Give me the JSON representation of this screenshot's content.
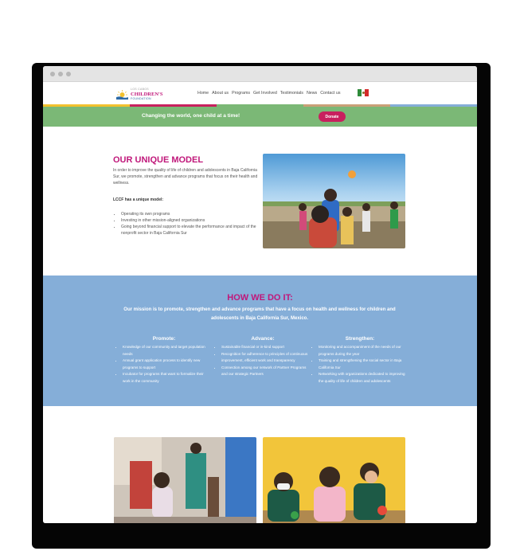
{
  "logo": {
    "small": "LOS CABOS",
    "main": "CHILDREN'S",
    "sub": "FOUNDATION"
  },
  "nav": [
    "Home",
    "About us",
    "Programs",
    "Get Involved",
    "Testimonials",
    "News",
    "Contact us"
  ],
  "banner": {
    "text": "Changing the world, one child at a time!",
    "donate": "Donate"
  },
  "model": {
    "title": "OUR UNIQUE MODEL",
    "intro": "In order to improve the quality of life of children and adolescents in Baja California Sur, we promote, strengthen and advance programs that focus on their health and wellness.",
    "lead": "LCCF has a unique model:",
    "items": [
      "Operating its own programs",
      "Investing in other mission-aligned organizations",
      "Going beyond financial support to elevate the performance and impact of the nonprofit sector in Baja California Sur"
    ]
  },
  "how": {
    "title": "HOW WE DO IT:",
    "intro": "Our mission is to promote, strengthen and advance programs that have a focus on health and wellness for children and adolescents in Baja California Sur, Mexico.",
    "columns": [
      {
        "title": "Promote:",
        "items": [
          "Knowledge of our community and target population needs",
          "Annual grant application process to identify new programs to support",
          "Incubator for programs that want to formalize their work in the community"
        ]
      },
      {
        "title": "Advance:",
        "items": [
          "Sustainable financial or in-kind support",
          "Recognition for adherence to principles of continuous improvement, efficient work and transparency",
          "Connection among our network of Partner Programs and our strategic Partners"
        ]
      },
      {
        "title": "Strengthen:",
        "items": [
          "Monitoring and accompaniment of the needs of our programs during the year",
          "Training and strengthening the social sector in Baja California Sur",
          "Networking with organizations dedicated to improving the quality of life of children and adolescents"
        ]
      }
    ]
  },
  "colors": {
    "brand_pink": "#c0177a",
    "banner_green": "#7bb876",
    "how_blue": "#85aed8",
    "donate": "#c8205e",
    "stripes": [
      "#f2c12e",
      "#c8205e",
      "#7bb876",
      "#c9a077",
      "#85aed8"
    ]
  }
}
